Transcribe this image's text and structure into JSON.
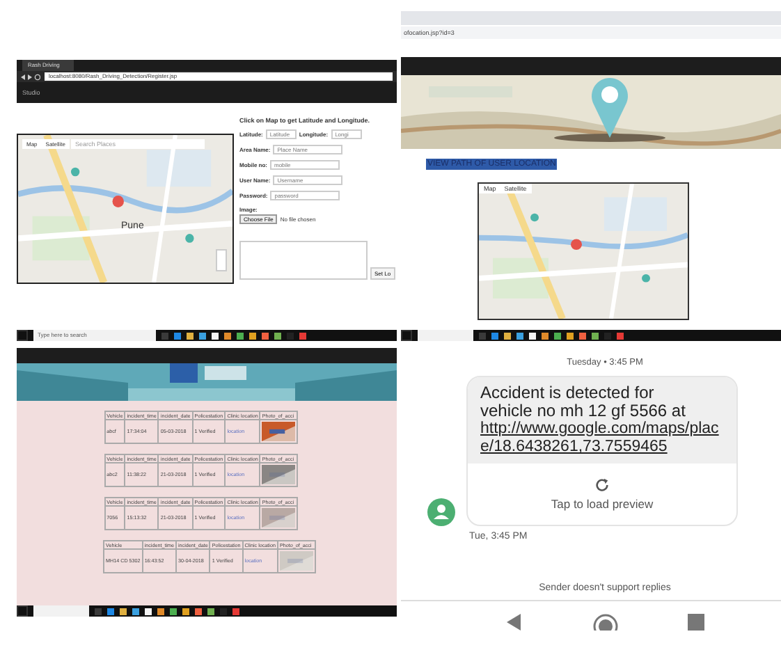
{
  "register_screen": {
    "tab_title": "Rash Driving",
    "url": "localhost:8080/Rash_Driving_Detection/Register.jsp",
    "brand": "Studio",
    "map": {
      "map_tab": "Map",
      "satellite_tab": "Satellite",
      "search_placeholder": "Search Places",
      "city": "Pune"
    },
    "form": {
      "heading": "Click on Map to get Latitude and Longitude.",
      "coordinates": [
        {
          "label": "Latitude:",
          "placeholder": "Latitude"
        },
        {
          "label": "Longitude:",
          "placeholder": "Longi"
        }
      ],
      "fields": [
        {
          "label": "Area Name:",
          "placeholder": "Place Name"
        },
        {
          "label": "Mobile no:",
          "placeholder": "mobile"
        },
        {
          "label": "User Name:",
          "placeholder": "Username"
        },
        {
          "label": "Password:",
          "placeholder": "password"
        }
      ],
      "image_label": "Image:",
      "choose_file": "Choose File",
      "file_status": "No file chosen",
      "set_button": "Set Lo"
    },
    "taskbar_search": "Type here to search"
  },
  "location_screen": {
    "url": "ofocation.jsp?id=3",
    "heading": "VIEW PATH OF USER LOCATION",
    "map": {
      "map_tab": "Map",
      "satellite_tab": "Satellite"
    }
  },
  "accidents_screen": {
    "tables": [
      {
        "columns": [
          "Vehicle",
          "incident_time",
          "incident_date",
          "Policestation",
          "Clinic location",
          "Photo_of_acci"
        ],
        "values": [
          "abcf",
          "17:34:04",
          "05-03-2018",
          "1 Verified",
          "location"
        ]
      },
      {
        "columns": [
          "Vehicle",
          "incident_time",
          "incident_date",
          "Policestation",
          "Clinic location",
          "Photo_of_acci"
        ],
        "values": [
          "abc2",
          "11:38:22",
          "21-03-2018",
          "1 Verified",
          "location"
        ]
      },
      {
        "columns": [
          "Vehicle",
          "incident_time",
          "incident_date",
          "Policestation",
          "Clinic location",
          "Photo_of_acci"
        ],
        "values": [
          "7056",
          "15:13:32",
          "21-03-2018",
          "1 Verified",
          "location"
        ]
      },
      {
        "columns": [
          "Vehicle",
          "incident_time",
          "incident_date",
          "Policestation",
          "Clinic location",
          "Photo_of_acci"
        ],
        "values": [
          "MH14 CD 5302",
          "16:43:52",
          "30-04-2018",
          "1 Verified",
          "location"
        ]
      }
    ]
  },
  "message_screen": {
    "day_stamp": "Tuesday • 3:45 PM",
    "message": "Accident is detected for vehicle no  mh 12 gf 5566 at",
    "link": "http://www.google.com/maps/place/18.6438261,73.7559465",
    "preview": "Tap to load preview",
    "time": "Tue, 3:45 PM",
    "footer": "Sender doesn't support replies"
  }
}
